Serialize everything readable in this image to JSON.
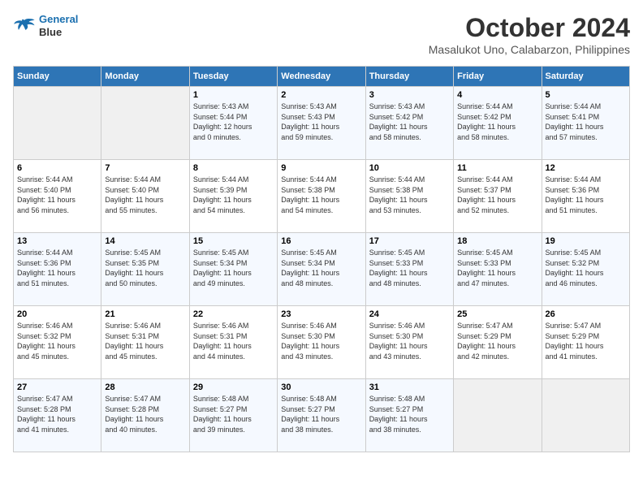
{
  "header": {
    "logo_line1": "General",
    "logo_line2": "Blue",
    "month_title": "October 2024",
    "subtitle": "Masalukot Uno, Calabarzon, Philippines"
  },
  "columns": [
    "Sunday",
    "Monday",
    "Tuesday",
    "Wednesday",
    "Thursday",
    "Friday",
    "Saturday"
  ],
  "weeks": [
    [
      {
        "day": "",
        "info": ""
      },
      {
        "day": "",
        "info": ""
      },
      {
        "day": "1",
        "info": "Sunrise: 5:43 AM\nSunset: 5:44 PM\nDaylight: 12 hours\nand 0 minutes."
      },
      {
        "day": "2",
        "info": "Sunrise: 5:43 AM\nSunset: 5:43 PM\nDaylight: 11 hours\nand 59 minutes."
      },
      {
        "day": "3",
        "info": "Sunrise: 5:43 AM\nSunset: 5:42 PM\nDaylight: 11 hours\nand 58 minutes."
      },
      {
        "day": "4",
        "info": "Sunrise: 5:44 AM\nSunset: 5:42 PM\nDaylight: 11 hours\nand 58 minutes."
      },
      {
        "day": "5",
        "info": "Sunrise: 5:44 AM\nSunset: 5:41 PM\nDaylight: 11 hours\nand 57 minutes."
      }
    ],
    [
      {
        "day": "6",
        "info": "Sunrise: 5:44 AM\nSunset: 5:40 PM\nDaylight: 11 hours\nand 56 minutes."
      },
      {
        "day": "7",
        "info": "Sunrise: 5:44 AM\nSunset: 5:40 PM\nDaylight: 11 hours\nand 55 minutes."
      },
      {
        "day": "8",
        "info": "Sunrise: 5:44 AM\nSunset: 5:39 PM\nDaylight: 11 hours\nand 54 minutes."
      },
      {
        "day": "9",
        "info": "Sunrise: 5:44 AM\nSunset: 5:38 PM\nDaylight: 11 hours\nand 54 minutes."
      },
      {
        "day": "10",
        "info": "Sunrise: 5:44 AM\nSunset: 5:38 PM\nDaylight: 11 hours\nand 53 minutes."
      },
      {
        "day": "11",
        "info": "Sunrise: 5:44 AM\nSunset: 5:37 PM\nDaylight: 11 hours\nand 52 minutes."
      },
      {
        "day": "12",
        "info": "Sunrise: 5:44 AM\nSunset: 5:36 PM\nDaylight: 11 hours\nand 51 minutes."
      }
    ],
    [
      {
        "day": "13",
        "info": "Sunrise: 5:44 AM\nSunset: 5:36 PM\nDaylight: 11 hours\nand 51 minutes."
      },
      {
        "day": "14",
        "info": "Sunrise: 5:45 AM\nSunset: 5:35 PM\nDaylight: 11 hours\nand 50 minutes."
      },
      {
        "day": "15",
        "info": "Sunrise: 5:45 AM\nSunset: 5:34 PM\nDaylight: 11 hours\nand 49 minutes."
      },
      {
        "day": "16",
        "info": "Sunrise: 5:45 AM\nSunset: 5:34 PM\nDaylight: 11 hours\nand 48 minutes."
      },
      {
        "day": "17",
        "info": "Sunrise: 5:45 AM\nSunset: 5:33 PM\nDaylight: 11 hours\nand 48 minutes."
      },
      {
        "day": "18",
        "info": "Sunrise: 5:45 AM\nSunset: 5:33 PM\nDaylight: 11 hours\nand 47 minutes."
      },
      {
        "day": "19",
        "info": "Sunrise: 5:45 AM\nSunset: 5:32 PM\nDaylight: 11 hours\nand 46 minutes."
      }
    ],
    [
      {
        "day": "20",
        "info": "Sunrise: 5:46 AM\nSunset: 5:32 PM\nDaylight: 11 hours\nand 45 minutes."
      },
      {
        "day": "21",
        "info": "Sunrise: 5:46 AM\nSunset: 5:31 PM\nDaylight: 11 hours\nand 45 minutes."
      },
      {
        "day": "22",
        "info": "Sunrise: 5:46 AM\nSunset: 5:31 PM\nDaylight: 11 hours\nand 44 minutes."
      },
      {
        "day": "23",
        "info": "Sunrise: 5:46 AM\nSunset: 5:30 PM\nDaylight: 11 hours\nand 43 minutes."
      },
      {
        "day": "24",
        "info": "Sunrise: 5:46 AM\nSunset: 5:30 PM\nDaylight: 11 hours\nand 43 minutes."
      },
      {
        "day": "25",
        "info": "Sunrise: 5:47 AM\nSunset: 5:29 PM\nDaylight: 11 hours\nand 42 minutes."
      },
      {
        "day": "26",
        "info": "Sunrise: 5:47 AM\nSunset: 5:29 PM\nDaylight: 11 hours\nand 41 minutes."
      }
    ],
    [
      {
        "day": "27",
        "info": "Sunrise: 5:47 AM\nSunset: 5:28 PM\nDaylight: 11 hours\nand 41 minutes."
      },
      {
        "day": "28",
        "info": "Sunrise: 5:47 AM\nSunset: 5:28 PM\nDaylight: 11 hours\nand 40 minutes."
      },
      {
        "day": "29",
        "info": "Sunrise: 5:48 AM\nSunset: 5:27 PM\nDaylight: 11 hours\nand 39 minutes."
      },
      {
        "day": "30",
        "info": "Sunrise: 5:48 AM\nSunset: 5:27 PM\nDaylight: 11 hours\nand 38 minutes."
      },
      {
        "day": "31",
        "info": "Sunrise: 5:48 AM\nSunset: 5:27 PM\nDaylight: 11 hours\nand 38 minutes."
      },
      {
        "day": "",
        "info": ""
      },
      {
        "day": "",
        "info": ""
      }
    ]
  ]
}
